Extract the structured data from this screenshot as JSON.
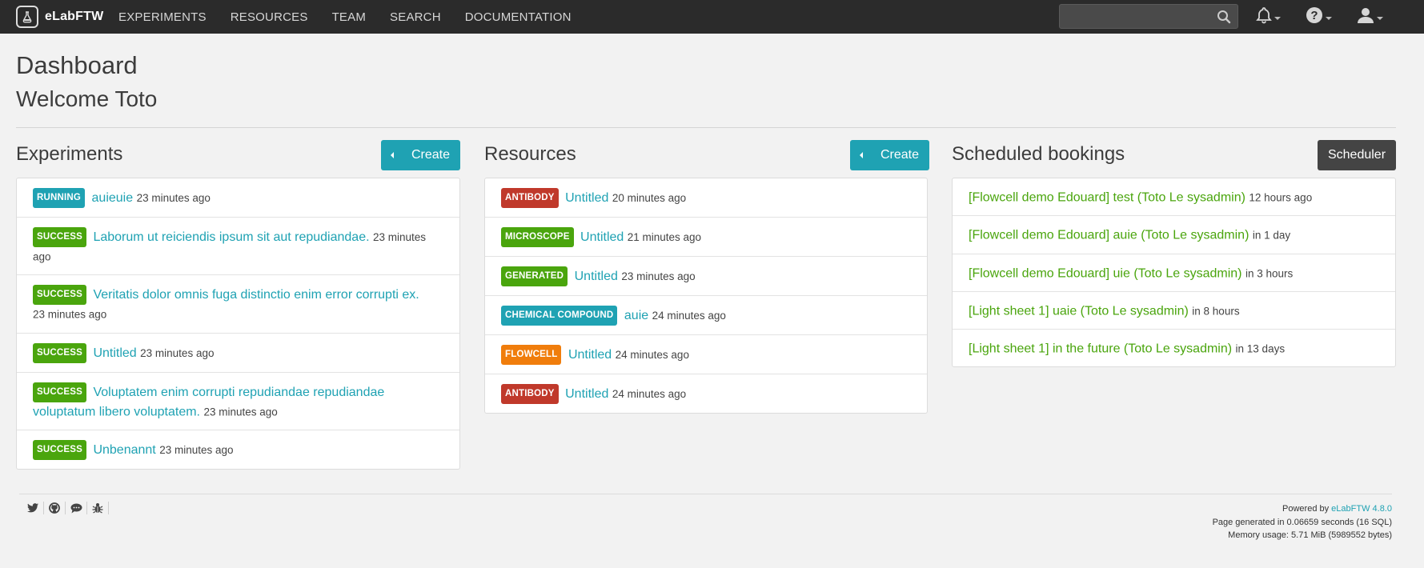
{
  "navbar": {
    "brand": "eLabFTW",
    "links": [
      "EXPERIMENTS",
      "RESOURCES",
      "TEAM",
      "SEARCH",
      "DOCUMENTATION"
    ],
    "search_placeholder": "",
    "icons": [
      "bell-icon",
      "help-icon",
      "user-icon"
    ]
  },
  "page": {
    "title": "Dashboard",
    "welcome": "Welcome Toto"
  },
  "experiments": {
    "title": "Experiments",
    "create_label": "Create",
    "items": [
      {
        "status": "RUNNING",
        "color": "#1fa2b3",
        "title": "auieuie",
        "time": "23 minutes ago"
      },
      {
        "status": "SUCCESS",
        "color": "#4aa50d",
        "title": "Laborum ut reiciendis ipsum sit aut repudiandae.",
        "time": "23 minutes ago"
      },
      {
        "status": "SUCCESS",
        "color": "#4aa50d",
        "title": "Veritatis dolor omnis fuga distinctio enim error corrupti ex.",
        "time": "23 minutes ago"
      },
      {
        "status": "SUCCESS",
        "color": "#4aa50d",
        "title": "Untitled",
        "time": "23 minutes ago"
      },
      {
        "status": "SUCCESS",
        "color": "#4aa50d",
        "title": "Voluptatem enim corrupti repudiandae repudiandae voluptatum libero voluptatem.",
        "time": "23 minutes ago"
      },
      {
        "status": "SUCCESS",
        "color": "#4aa50d",
        "title": "Unbenannt",
        "time": "23 minutes ago"
      }
    ]
  },
  "resources": {
    "title": "Resources",
    "create_label": "Create",
    "items": [
      {
        "category": "ANTIBODY",
        "color": "#c0392b",
        "title": "Untitled",
        "time": "20 minutes ago"
      },
      {
        "category": "MICROSCOPE",
        "color": "#4aa50d",
        "title": "Untitled",
        "time": "21 minutes ago"
      },
      {
        "category": "GENERATED",
        "color": "#4aa50d",
        "title": "Untitled",
        "time": "23 minutes ago"
      },
      {
        "category": "CHEMICAL COMPOUND",
        "color": "#1fa2b3",
        "title": "auie",
        "time": "24 minutes ago"
      },
      {
        "category": "FLOWCELL",
        "color": "#f07d0c",
        "title": "Untitled",
        "time": "24 minutes ago"
      },
      {
        "category": "ANTIBODY",
        "color": "#c0392b",
        "title": "Untitled",
        "time": "24 minutes ago"
      }
    ]
  },
  "bookings": {
    "title": "Scheduled bookings",
    "scheduler_label": "Scheduler",
    "items": [
      {
        "title": "[Flowcell demo Edouard] test (Toto Le sysadmin)",
        "time": "12 hours ago"
      },
      {
        "title": "[Flowcell demo Edouard] auie (Toto Le sysadmin)",
        "time": "in 1 day"
      },
      {
        "title": "[Flowcell demo Edouard] uie (Toto Le sysadmin)",
        "time": "in 3 hours"
      },
      {
        "title": "[Light sheet 1] uaie (Toto Le sysadmin)",
        "time": "in 8 hours"
      },
      {
        "title": "[Light sheet 1] in the future (Toto Le sysadmin)",
        "time": "in 13 days"
      }
    ]
  },
  "footer": {
    "powered_prefix": "Powered by",
    "powered_link": "eLabFTW 4.8.0",
    "generated": "Page generated in 0.06659 seconds (16 SQL)",
    "memory": "Memory usage: 5.71 MiB (5989552 bytes)",
    "icons": [
      "twitter-icon",
      "github-icon",
      "chat-icon",
      "bug-icon"
    ]
  }
}
